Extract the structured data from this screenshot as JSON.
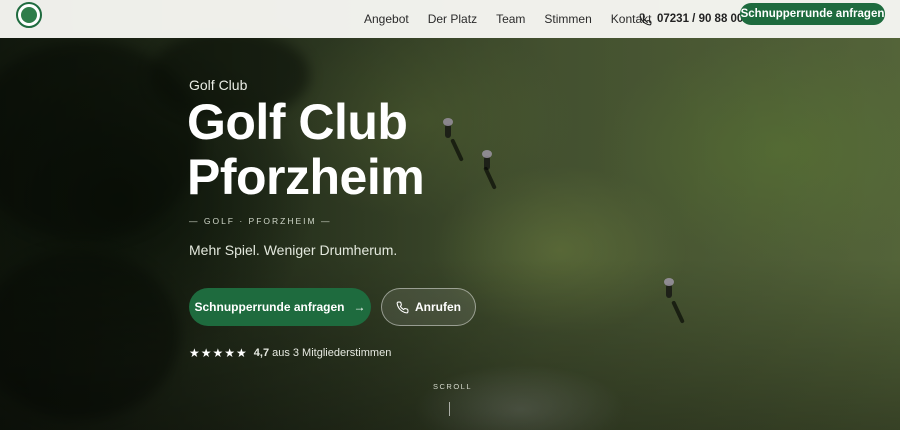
{
  "nav": {
    "items": [
      {
        "label": "Angebot"
      },
      {
        "label": "Der Platz"
      },
      {
        "label": "Team"
      },
      {
        "label": "Stimmen"
      },
      {
        "label": "Kontakt"
      }
    ],
    "phone": "07231 / 90 88 00",
    "cta_label": "Schnupperrunde anfragen",
    "logo_icon": "golf-club-logo-icon"
  },
  "hero": {
    "eyebrow": "Golf Club",
    "title_line1": "Golf Club",
    "title_line2": "Pforzheim",
    "tagline": "— GOLF · PFORZHEIM —",
    "subtitle": "Mehr Spiel. Weniger Drumherum.",
    "primary_button": "Schnupperrunde anfragen",
    "primary_button_icon": "arrow-right-icon",
    "secondary_button": "Anrufen",
    "secondary_button_icon": "phone-icon",
    "stars": "★★★★★",
    "rating_value": "4,7",
    "rating_text": "aus 3 Mitgliederstimmen",
    "scroll_label": "SCROLL"
  },
  "colors": {
    "accent": "#1e6b3e",
    "nav_background": "#f6f6f2"
  }
}
